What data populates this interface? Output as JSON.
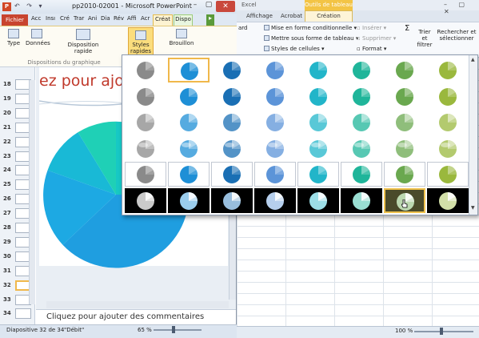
{
  "excel": {
    "title": "Excel",
    "context_tab": "Outils de tableau",
    "tabs": [
      "Affichage",
      "Acrobat",
      "Création"
    ],
    "active_tab_index": 2,
    "window_controls": [
      "–",
      "▢",
      "✕"
    ],
    "ribbon": {
      "col1": [
        "ard",
        "",
        ""
      ],
      "conditional": "Mise en forme conditionnelle",
      "table_format": "Mettre sous forme de tableau",
      "cell_styles": "Styles de cellules",
      "insert": "Insérer",
      "delete": "Supprimer",
      "format": "Format",
      "sum": "Σ",
      "sort_filter": "Trier et filtrer",
      "find_select": "Rechercher et sélectionner"
    },
    "zoom": "100 %"
  },
  "ppt": {
    "logo": "P",
    "qat": "↶ ↷ ▾",
    "title": "pp2010-02001 - Microsoft PowerPoint",
    "file_tab": "Fichier",
    "tabs": [
      "Acc",
      "Insı",
      "Cré",
      "Trar",
      "Ani",
      "Dia",
      "Rév",
      "Affi",
      "Acr"
    ],
    "creation_tab": "Créat",
    "dispo_tab": "Dispo",
    "more_tab": "▸",
    "minimize": "–",
    "maximize": "▢",
    "close": "✕",
    "ribbon_buttons": {
      "type": "Type",
      "data": "Données",
      "layout": "Disposition rapide",
      "styles": "Styles rapides",
      "draft": "Brouillon"
    },
    "ribbon_group": "Dispositions du graphique",
    "thumbnails": [
      {
        "num": "18"
      },
      {
        "num": "19"
      },
      {
        "num": "20"
      },
      {
        "num": "21"
      },
      {
        "num": "22"
      },
      {
        "num": "23"
      },
      {
        "num": "24"
      },
      {
        "num": "25"
      },
      {
        "num": "26"
      },
      {
        "num": "27"
      },
      {
        "num": "28"
      },
      {
        "num": "29"
      },
      {
        "num": "30"
      },
      {
        "num": "31"
      },
      {
        "num": "32"
      },
      {
        "num": "33"
      },
      {
        "num": "34"
      }
    ],
    "selected_slide": "32",
    "slide_title": "ez pour ajou",
    "notes": "Cliquez pour ajouter des commentaires",
    "status_slide": "Diapositive 32 de 34",
    "status_theme": "\"Débit\"",
    "zoom": "65 %"
  },
  "gallery": {
    "rows": 6,
    "cols": 8,
    "colors": [
      "#8a8a8a",
      "#1e8fd6",
      "#1a6fb4",
      "#5c94d8",
      "#22b5c9",
      "#1fb59a",
      "#6aa84f",
      "#9ab83d"
    ],
    "selected": [
      0,
      1
    ],
    "hovered": [
      5,
      6
    ]
  }
}
